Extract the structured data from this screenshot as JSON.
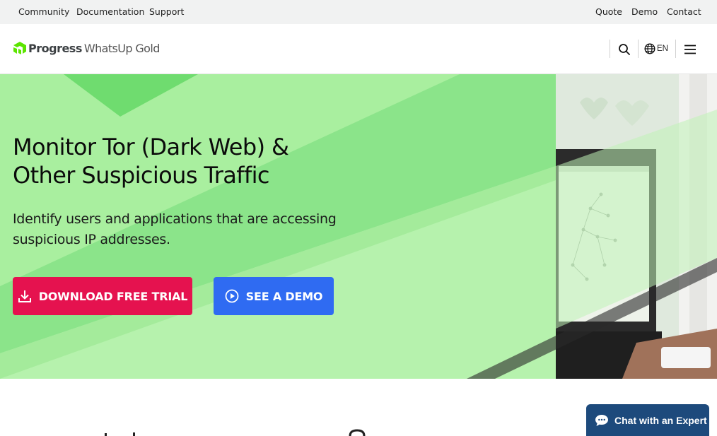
{
  "utility_nav": {
    "left": [
      "Community",
      "Documentation",
      "Support"
    ],
    "right": [
      "Quote",
      "Demo",
      "Contact"
    ]
  },
  "header": {
    "logo_brand": "Progress",
    "logo_product": "WhatsUp Gold",
    "language": "EN",
    "icons": [
      "search-icon",
      "globe-icon",
      "hamburger-menu-icon"
    ]
  },
  "hero": {
    "title_line1": "Monitor Tor (Dark Web) &",
    "title_line2": "Other Suspicious Traffic",
    "subtitle_line1": "Identify users and applications that are accessing",
    "subtitle_line2": "suspicious IP addresses.",
    "primary_cta": "DOWNLOAD FREE TRIAL",
    "secondary_cta": "SEE A DEMO"
  },
  "chat": {
    "label": "Chat with an Expert"
  },
  "colors": {
    "hero_green": "#8be48a",
    "trial_button": "#e5124f",
    "demo_button": "#2f6bf2",
    "chat_button": "#1d4a7c",
    "utility_bar": "#f1f2f2"
  }
}
